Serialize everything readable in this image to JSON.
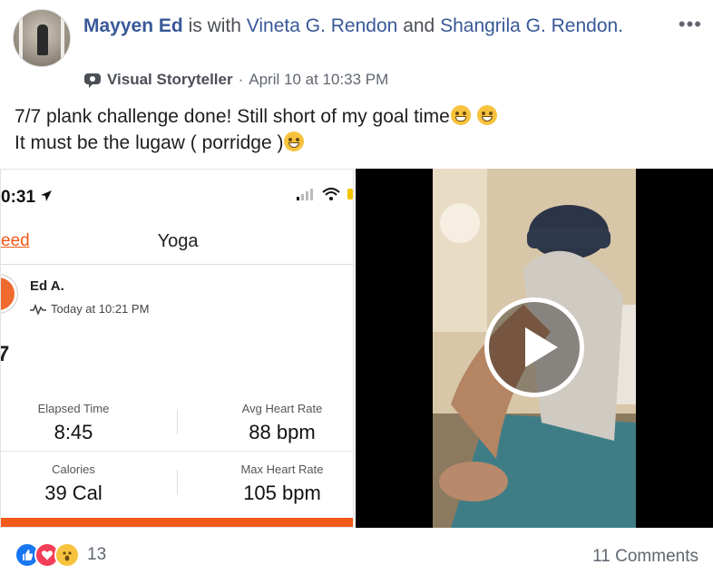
{
  "post": {
    "author": "Mayyen Ed",
    "with_text": "is with",
    "tagged_1": "Vineta G. Rendon",
    "and_text": "and",
    "tagged_2": "Shangrila G. Rendon.",
    "badge": "Visual Storyteller",
    "separator": "·",
    "timestamp": "April 10 at 10:33 PM",
    "text_line_1": "7/7 plank challenge done! Still short of my goal time",
    "text_line_2": "It must be the lugaw ( porridge )",
    "more_icon": "more-options-icon"
  },
  "phone_screenshot": {
    "status_time": "0:31",
    "back_label": "eed",
    "title": "Yoga",
    "user_name": "Ed A.",
    "user_time": "Today at 10:21 PM",
    "stray_char": "7",
    "stats": [
      {
        "label": "Elapsed Time",
        "value": "8:45"
      },
      {
        "label": "Avg Heart Rate",
        "value": "88 bpm"
      },
      {
        "label": "Calories",
        "value": "39 Cal"
      },
      {
        "label": "Max Heart Rate",
        "value": "105 bpm"
      }
    ],
    "accent_color": "#f05a1a"
  },
  "video": {
    "play_icon": "play-icon"
  },
  "footer": {
    "reaction_icons": [
      "like-icon",
      "love-icon",
      "wow-icon"
    ],
    "reaction_count": "13",
    "comments": "11 Comments"
  },
  "colors": {
    "link": "#385898",
    "meta": "#606770",
    "like": "#1877f2",
    "love": "#f33e58"
  }
}
